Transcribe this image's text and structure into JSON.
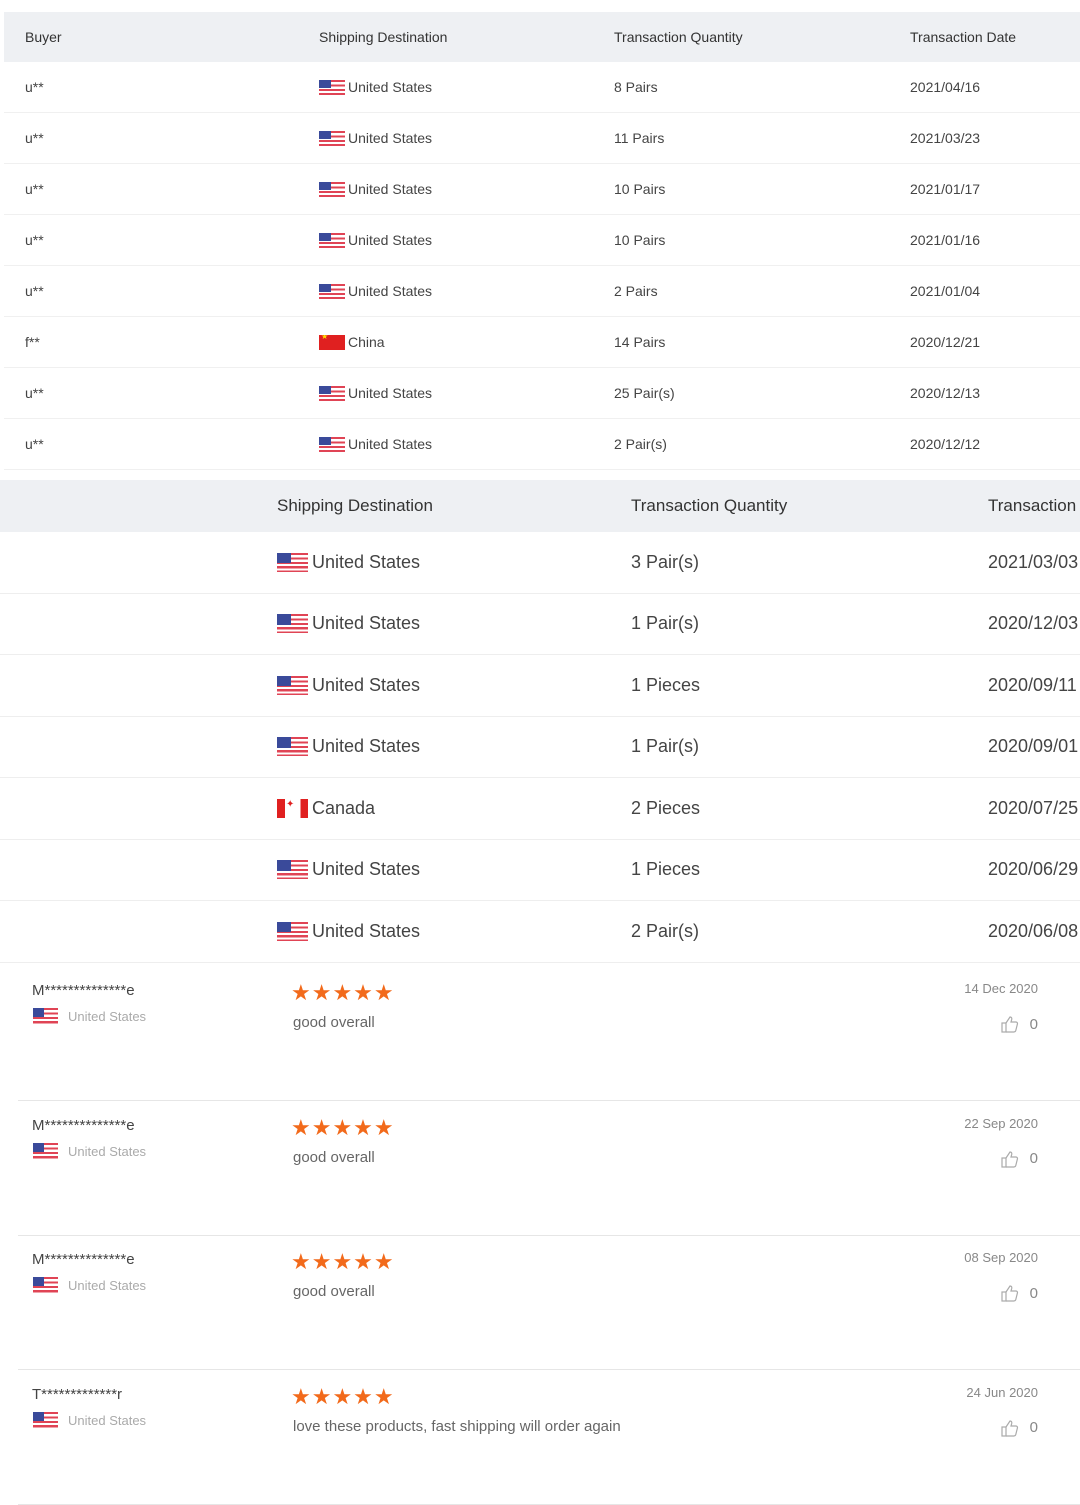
{
  "table1": {
    "headers": [
      "Buyer",
      "Shipping Destination",
      "Transaction Quantity",
      "Transaction Date"
    ],
    "rows": [
      {
        "buyer": "u**",
        "flag": "us",
        "country": "United States",
        "qty": "8 Pairs",
        "date": "2021/04/16"
      },
      {
        "buyer": "u**",
        "flag": "us",
        "country": "United States",
        "qty": "11 Pairs",
        "date": "2021/03/23"
      },
      {
        "buyer": "u**",
        "flag": "us",
        "country": "United States",
        "qty": "10 Pairs",
        "date": "2021/01/17"
      },
      {
        "buyer": "u**",
        "flag": "us",
        "country": "United States",
        "qty": "10 Pairs",
        "date": "2021/01/16"
      },
      {
        "buyer": "u**",
        "flag": "us",
        "country": "United States",
        "qty": "2 Pairs",
        "date": "2021/01/04"
      },
      {
        "buyer": "f**",
        "flag": "cn",
        "country": "China",
        "qty": "14 Pairs",
        "date": "2020/12/21"
      },
      {
        "buyer": "u**",
        "flag": "us",
        "country": "United States",
        "qty": "25 Pair(s)",
        "date": "2020/12/13"
      },
      {
        "buyer": "u**",
        "flag": "us",
        "country": "United States",
        "qty": "2 Pair(s)",
        "date": "2020/12/12"
      }
    ]
  },
  "table2": {
    "headers": [
      "Shipping Destination",
      "Transaction Quantity",
      "Transaction"
    ],
    "rows": [
      {
        "flag": "us",
        "country": "United States",
        "qty": "3 Pair(s)",
        "date": "2021/03/03"
      },
      {
        "flag": "us",
        "country": "United States",
        "qty": "1 Pair(s)",
        "date": "2020/12/03"
      },
      {
        "flag": "us",
        "country": "United States",
        "qty": "1 Pieces",
        "date": "2020/09/11"
      },
      {
        "flag": "us",
        "country": "United States",
        "qty": "1 Pair(s)",
        "date": "2020/09/01"
      },
      {
        "flag": "ca",
        "country": "Canada",
        "qty": "2 Pieces",
        "date": "2020/07/25"
      },
      {
        "flag": "us",
        "country": "United States",
        "qty": "1 Pieces",
        "date": "2020/06/29"
      },
      {
        "flag": "us",
        "country": "United States",
        "qty": "2 Pair(s)",
        "date": "2020/06/08"
      }
    ]
  },
  "reviews": [
    {
      "name": "M**************e",
      "country": "United States",
      "stars": 5,
      "stars_text": "★★★★★",
      "text": "good overall",
      "date": "14 Dec 2020",
      "likes": "0"
    },
    {
      "name": "M**************e",
      "country": "United States",
      "stars": 5,
      "stars_text": "★★★★★",
      "text": "good overall",
      "date": "22 Sep 2020",
      "likes": "0"
    },
    {
      "name": "M**************e",
      "country": "United States",
      "stars": 5,
      "stars_text": "★★★★★",
      "text": "good overall",
      "date": "08 Sep 2020",
      "likes": "0"
    },
    {
      "name": "T*************r",
      "country": "United States",
      "stars": 5,
      "stars_text": "★★★★★",
      "text": "love these products, fast shipping will order again",
      "date": "24 Jun 2020",
      "likes": "0"
    }
  ],
  "colors": {
    "star": "#f26a1b",
    "header_bg": "#eef0f3"
  }
}
